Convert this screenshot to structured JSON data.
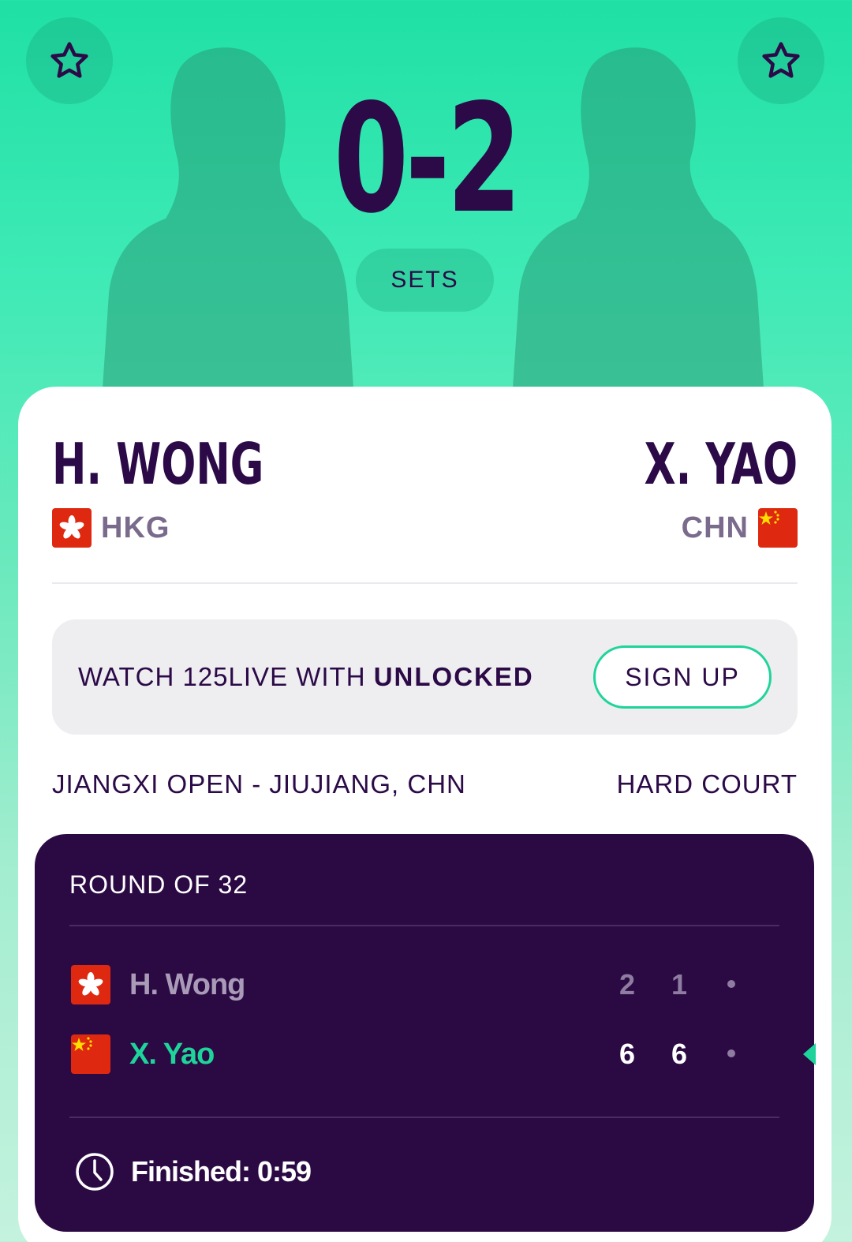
{
  "header": {
    "score": "0-2",
    "score_unit": "SETS"
  },
  "players": {
    "left": {
      "name": "H. WONG",
      "country": "HKG"
    },
    "right": {
      "name": "X. YAO",
      "country": "CHN"
    }
  },
  "promo": {
    "text_prefix": "WATCH 125LIVE WITH ",
    "text_bold": "UNLOCKED",
    "button_label": "SIGN UP"
  },
  "event": {
    "tournament": "JIANGXI OPEN - JIUJIANG, CHN",
    "surface": "HARD COURT"
  },
  "match": {
    "round": "ROUND OF 32",
    "rows": [
      {
        "name": "H. Wong",
        "country": "HKG",
        "set1": "2",
        "set2": "1",
        "winner": false
      },
      {
        "name": "X. Yao",
        "country": "CHN",
        "set1": "6",
        "set2": "6",
        "winner": true
      }
    ],
    "status": "Finished: 0:59"
  },
  "icons": [
    "star-icon",
    "clock-icon",
    "hkg-flag-icon",
    "chn-flag-icon",
    "player-silhouette"
  ],
  "colors": {
    "accent": "#1fd49a",
    "dark_purple": "#2b0a44",
    "muted": "#7a6a8c"
  }
}
